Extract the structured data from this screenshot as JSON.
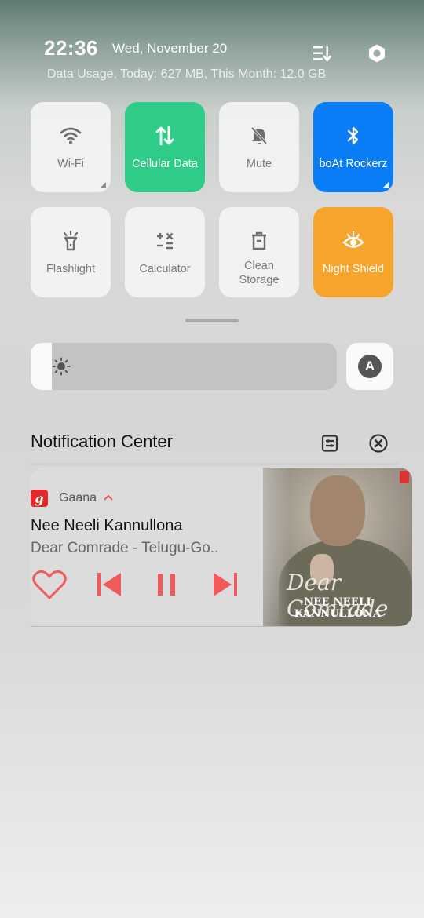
{
  "header": {
    "time": "22:36",
    "date": "Wed, November 20",
    "data_usage": "Data Usage, Today: 627 MB, This Month: 12.0 GB",
    "icons": [
      "list-sort-icon",
      "settings-hexagon-icon"
    ]
  },
  "quick_tiles": [
    {
      "label": "Wi-Fi",
      "icon": "wifi-icon",
      "state": "off"
    },
    {
      "label": "Cellular Data",
      "icon": "cellular-data-icon",
      "state": "on",
      "color": "#2ecc86"
    },
    {
      "label": "Mute",
      "icon": "mute-bell-icon",
      "state": "off"
    },
    {
      "label": "boAt Rockerz",
      "icon": "bluetooth-icon",
      "state": "on",
      "color": "#0a7cf5"
    },
    {
      "label": "Flashlight",
      "icon": "flashlight-icon",
      "state": "off"
    },
    {
      "label": "Calculator",
      "icon": "calculator-icon",
      "state": "off"
    },
    {
      "label": "Clean\nStorage",
      "icon": "trash-icon",
      "state": "off"
    },
    {
      "label": "Night Shield",
      "icon": "eye-icon",
      "state": "on",
      "color": "#f7a42c"
    }
  ],
  "brightness": {
    "level": 0.07,
    "auto_label": "A"
  },
  "notification_center": {
    "title": "Notification Center"
  },
  "media_notification": {
    "app_name": "Gaana",
    "app_logo_letter": "g",
    "song_title": "Nee Neeli Kannullona",
    "artist": "Dear Comrade - Telugu-Go..",
    "album_art_caption": "NEE NEELI KANNULLONA",
    "album_art_logo": "Dear Comrade",
    "accent_color": "#f05a5a"
  }
}
